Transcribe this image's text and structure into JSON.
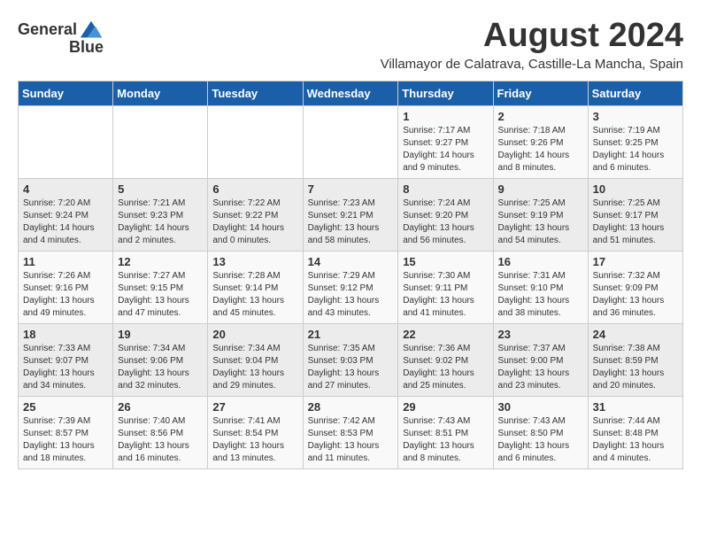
{
  "header": {
    "logo_general": "General",
    "logo_blue": "Blue",
    "month_year": "August 2024",
    "location": "Villamayor de Calatrava, Castille-La Mancha, Spain"
  },
  "days_of_week": [
    "Sunday",
    "Monday",
    "Tuesday",
    "Wednesday",
    "Thursday",
    "Friday",
    "Saturday"
  ],
  "weeks": [
    [
      {
        "day": "",
        "info": ""
      },
      {
        "day": "",
        "info": ""
      },
      {
        "day": "",
        "info": ""
      },
      {
        "day": "",
        "info": ""
      },
      {
        "day": "1",
        "info": "Sunrise: 7:17 AM\nSunset: 9:27 PM\nDaylight: 14 hours and 9 minutes."
      },
      {
        "day": "2",
        "info": "Sunrise: 7:18 AM\nSunset: 9:26 PM\nDaylight: 14 hours and 8 minutes."
      },
      {
        "day": "3",
        "info": "Sunrise: 7:19 AM\nSunset: 9:25 PM\nDaylight: 14 hours and 6 minutes."
      }
    ],
    [
      {
        "day": "4",
        "info": "Sunrise: 7:20 AM\nSunset: 9:24 PM\nDaylight: 14 hours and 4 minutes."
      },
      {
        "day": "5",
        "info": "Sunrise: 7:21 AM\nSunset: 9:23 PM\nDaylight: 14 hours and 2 minutes."
      },
      {
        "day": "6",
        "info": "Sunrise: 7:22 AM\nSunset: 9:22 PM\nDaylight: 14 hours and 0 minutes."
      },
      {
        "day": "7",
        "info": "Sunrise: 7:23 AM\nSunset: 9:21 PM\nDaylight: 13 hours and 58 minutes."
      },
      {
        "day": "8",
        "info": "Sunrise: 7:24 AM\nSunset: 9:20 PM\nDaylight: 13 hours and 56 minutes."
      },
      {
        "day": "9",
        "info": "Sunrise: 7:25 AM\nSunset: 9:19 PM\nDaylight: 13 hours and 54 minutes."
      },
      {
        "day": "10",
        "info": "Sunrise: 7:25 AM\nSunset: 9:17 PM\nDaylight: 13 hours and 51 minutes."
      }
    ],
    [
      {
        "day": "11",
        "info": "Sunrise: 7:26 AM\nSunset: 9:16 PM\nDaylight: 13 hours and 49 minutes."
      },
      {
        "day": "12",
        "info": "Sunrise: 7:27 AM\nSunset: 9:15 PM\nDaylight: 13 hours and 47 minutes."
      },
      {
        "day": "13",
        "info": "Sunrise: 7:28 AM\nSunset: 9:14 PM\nDaylight: 13 hours and 45 minutes."
      },
      {
        "day": "14",
        "info": "Sunrise: 7:29 AM\nSunset: 9:12 PM\nDaylight: 13 hours and 43 minutes."
      },
      {
        "day": "15",
        "info": "Sunrise: 7:30 AM\nSunset: 9:11 PM\nDaylight: 13 hours and 41 minutes."
      },
      {
        "day": "16",
        "info": "Sunrise: 7:31 AM\nSunset: 9:10 PM\nDaylight: 13 hours and 38 minutes."
      },
      {
        "day": "17",
        "info": "Sunrise: 7:32 AM\nSunset: 9:09 PM\nDaylight: 13 hours and 36 minutes."
      }
    ],
    [
      {
        "day": "18",
        "info": "Sunrise: 7:33 AM\nSunset: 9:07 PM\nDaylight: 13 hours and 34 minutes."
      },
      {
        "day": "19",
        "info": "Sunrise: 7:34 AM\nSunset: 9:06 PM\nDaylight: 13 hours and 32 minutes."
      },
      {
        "day": "20",
        "info": "Sunrise: 7:34 AM\nSunset: 9:04 PM\nDaylight: 13 hours and 29 minutes."
      },
      {
        "day": "21",
        "info": "Sunrise: 7:35 AM\nSunset: 9:03 PM\nDaylight: 13 hours and 27 minutes."
      },
      {
        "day": "22",
        "info": "Sunrise: 7:36 AM\nSunset: 9:02 PM\nDaylight: 13 hours and 25 minutes."
      },
      {
        "day": "23",
        "info": "Sunrise: 7:37 AM\nSunset: 9:00 PM\nDaylight: 13 hours and 23 minutes."
      },
      {
        "day": "24",
        "info": "Sunrise: 7:38 AM\nSunset: 8:59 PM\nDaylight: 13 hours and 20 minutes."
      }
    ],
    [
      {
        "day": "25",
        "info": "Sunrise: 7:39 AM\nSunset: 8:57 PM\nDaylight: 13 hours and 18 minutes."
      },
      {
        "day": "26",
        "info": "Sunrise: 7:40 AM\nSunset: 8:56 PM\nDaylight: 13 hours and 16 minutes."
      },
      {
        "day": "27",
        "info": "Sunrise: 7:41 AM\nSunset: 8:54 PM\nDaylight: 13 hours and 13 minutes."
      },
      {
        "day": "28",
        "info": "Sunrise: 7:42 AM\nSunset: 8:53 PM\nDaylight: 13 hours and 11 minutes."
      },
      {
        "day": "29",
        "info": "Sunrise: 7:43 AM\nSunset: 8:51 PM\nDaylight: 13 hours and 8 minutes."
      },
      {
        "day": "30",
        "info": "Sunrise: 7:43 AM\nSunset: 8:50 PM\nDaylight: 13 hours and 6 minutes."
      },
      {
        "day": "31",
        "info": "Sunrise: 7:44 AM\nSunset: 8:48 PM\nDaylight: 13 hours and 4 minutes."
      }
    ]
  ]
}
